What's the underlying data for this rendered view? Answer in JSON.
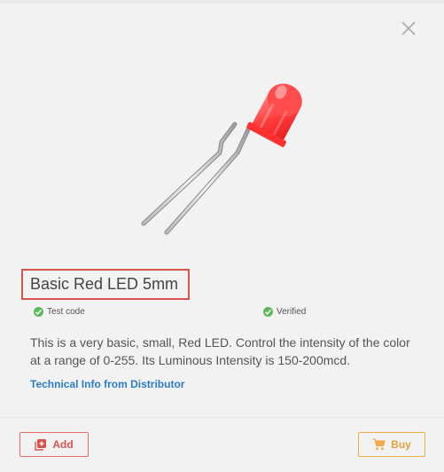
{
  "product": {
    "title": "Basic Red LED 5mm",
    "badges": [
      {
        "label": "Test code",
        "icon": "check-circle-icon"
      },
      {
        "label": "Verified",
        "icon": "check-circle-icon"
      }
    ],
    "description": "This is a very basic, small, Red LED. Control the intensity of the color at a range of 0-255. Its Luminous Intensity is 150-200mcd.",
    "tech_link_label": "Technical Info from Distributor"
  },
  "actions": {
    "add_label": "Add",
    "buy_label": "Buy"
  },
  "colors": {
    "title_border": "#d9534f",
    "add_accent": "#d9534f",
    "buy_accent": "#f0ad4e",
    "link": "#2b7cc7",
    "check": "#5cb85c"
  },
  "icons": {
    "close": "close-icon",
    "add": "add-box-icon",
    "buy": "cart-icon"
  }
}
